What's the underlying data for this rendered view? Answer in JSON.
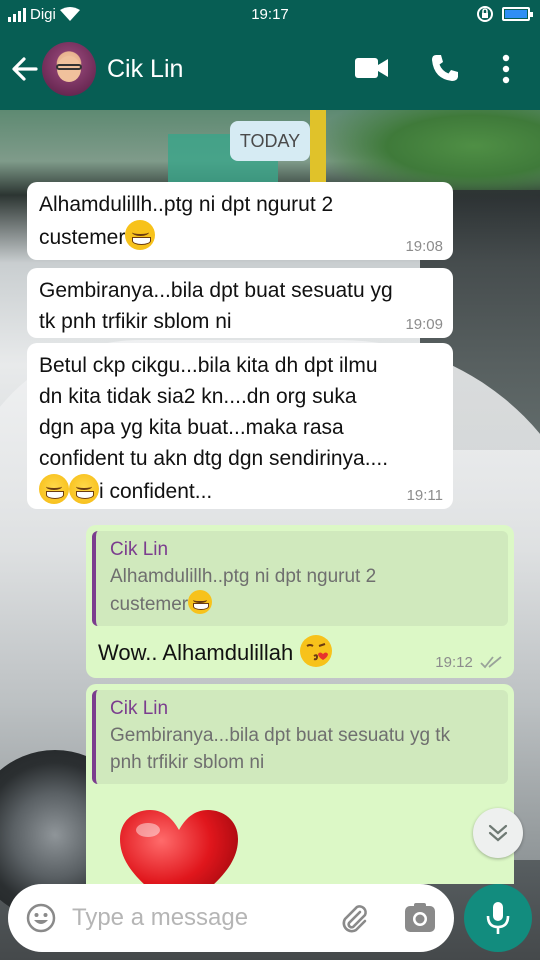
{
  "status_bar": {
    "carrier": "Digi",
    "time": "19:17"
  },
  "header": {
    "contact_name": "Cik Lin"
  },
  "date_chip": "TODAY",
  "messages": [
    {
      "direction": "incoming",
      "line1": "Alhamdulillh..ptg ni dpt ngurut 2",
      "line2": "custemer",
      "time": "19:08"
    },
    {
      "direction": "incoming",
      "line1": "Gembiranya...bila dpt buat sesuatu yg",
      "line2": "tk pnh trfikir sblom ni",
      "time": "19:09"
    },
    {
      "direction": "incoming",
      "line1": "Betul ckp cikgu...bila kita dh dpt ilmu",
      "line2": "dn kita tidak sia2 kn....dn org suka",
      "line3": "dgn apa yg kita buat...maka rasa",
      "line4": "confident tu akn dtg dgn sendirinya....",
      "line5": "i confident...",
      "time": "19:11"
    },
    {
      "direction": "outgoing",
      "quote_name": "Cik Lin",
      "quote_line1": "Alhamdulillh..ptg ni dpt ngurut 2",
      "quote_line2": "custemer",
      "text": "Wow..  Alhamdulillah",
      "time": "19:12"
    },
    {
      "direction": "outgoing",
      "quote_name": "Cik Lin",
      "quote_line1": "Gembiranya...bila dpt buat sesuatu yg tk",
      "quote_line2": "pnh trfikir sblom ni"
    }
  ],
  "composer": {
    "placeholder": "Type a message"
  },
  "colors": {
    "header": "#075e54",
    "incoming_bubble": "#ffffff",
    "outgoing_bubble": "#dcf8c6",
    "quote_accent": "#7b3d8e",
    "mic_button": "#128c7e"
  },
  "icons": [
    "back-arrow-icon",
    "video-call-icon",
    "phone-icon",
    "more-vert-icon",
    "emoji-icon",
    "attach-icon",
    "camera-icon",
    "mic-icon",
    "scroll-down-icon",
    "double-check-icon"
  ]
}
